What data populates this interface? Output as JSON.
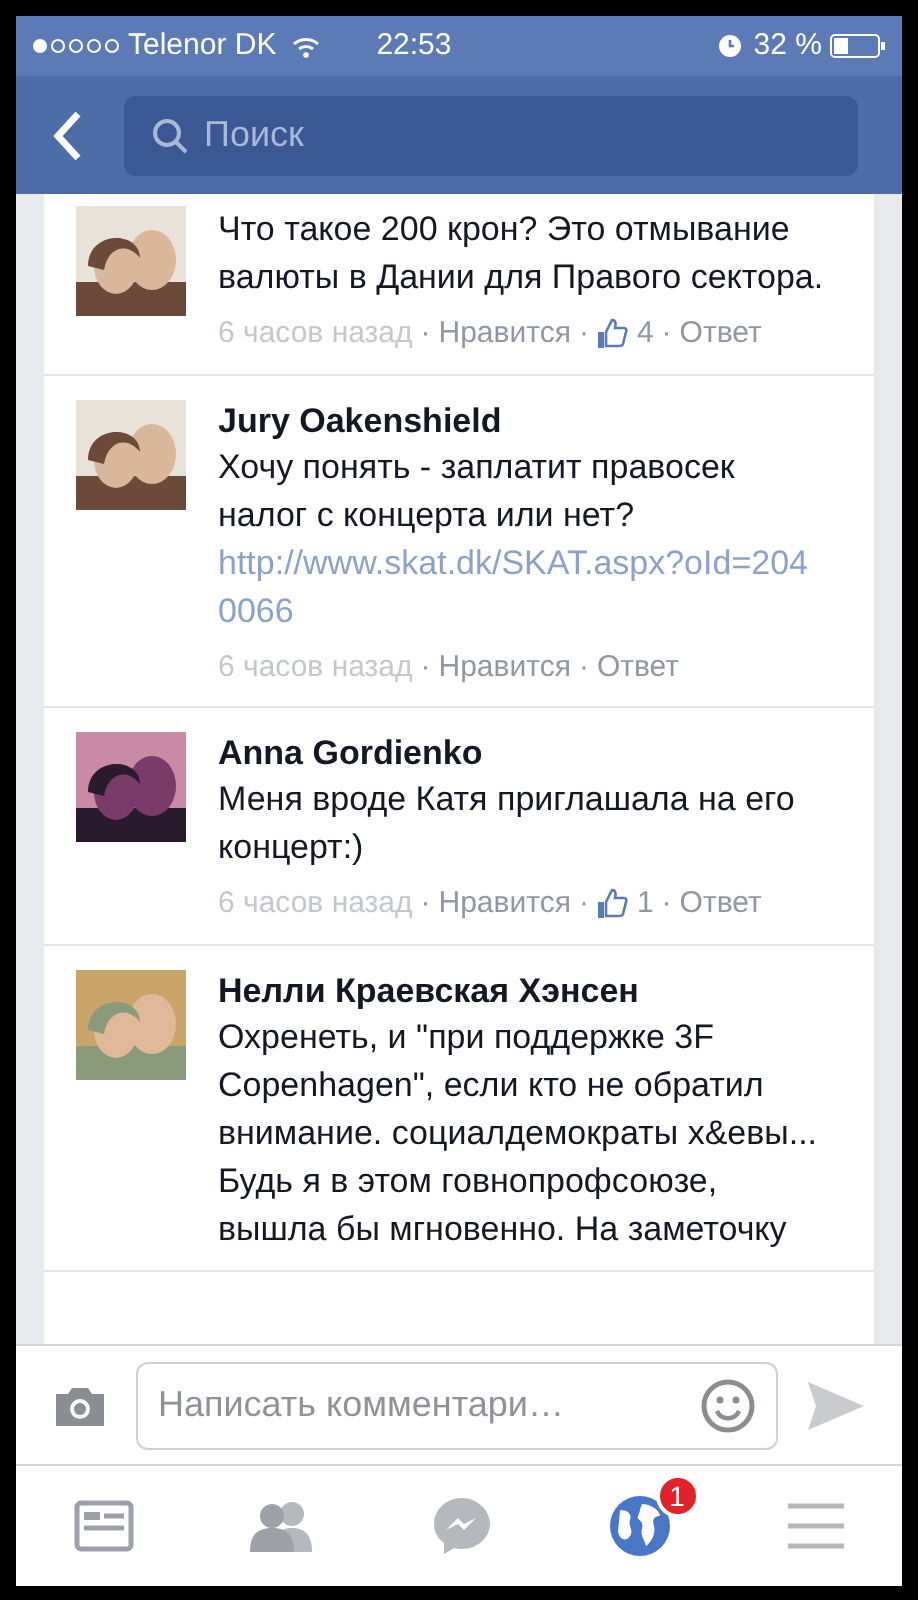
{
  "status_bar": {
    "carrier": "Telenor DK",
    "time": "22:53",
    "battery": "32 %"
  },
  "search": {
    "placeholder": "Поиск"
  },
  "comments": [
    {
      "text": "Что такое 200 крон? Это отмывание валюты в Дании для Правого сектора.",
      "meta": [
        {
          "kind": "time",
          "text": "6 часов назад"
        },
        {
          "kind": "sep",
          "text": "·"
        },
        {
          "kind": "like",
          "text": "Нравится"
        },
        {
          "kind": "sep",
          "text": "·"
        },
        {
          "kind": "likes",
          "text": "4"
        },
        {
          "kind": "sep",
          "text": "·"
        },
        {
          "kind": "reply",
          "text": "Ответ"
        }
      ]
    },
    {
      "author": "Jury Oakenshield",
      "text": "Хочу понять - заплатит правосек налог с концерта или нет?",
      "link": "http://www.skat.dk/SKAT.aspx?oId=2040066",
      "meta": [
        {
          "kind": "time",
          "text": "6 часов назад"
        },
        {
          "kind": "sep",
          "text": "·"
        },
        {
          "kind": "like",
          "text": "Нравится"
        },
        {
          "kind": "sep",
          "text": "·"
        },
        {
          "kind": "reply",
          "text": "Ответ"
        }
      ]
    },
    {
      "author": "Anna Gordienko",
      "text": "Меня вроде Катя приглашала на его концерт:)",
      "meta": [
        {
          "kind": "time",
          "text": "6 часов назад"
        },
        {
          "kind": "sep",
          "text": "·"
        },
        {
          "kind": "like",
          "text": "Нравится"
        },
        {
          "kind": "sep",
          "text": "·"
        },
        {
          "kind": "likes",
          "text": "1"
        },
        {
          "kind": "sep",
          "text": "·"
        },
        {
          "kind": "reply",
          "text": "Ответ"
        }
      ]
    },
    {
      "author": "Нелли Краевская Хэнсен",
      "text": "Охренеть, и \"при поддержке 3F Copenhagen\", если кто не обратил внимание. социалдемократы х&евы... Будь я в этом говнопрофсоюзе, вышла бы мгновенно. На заметочку"
    }
  ],
  "composer": {
    "placeholder": "Написать комментари…"
  },
  "tab_bar": [
    {
      "kind": "feed"
    },
    {
      "kind": "friends"
    },
    {
      "kind": "messenger"
    },
    {
      "kind": "globe",
      "badge": "1"
    },
    {
      "kind": "menu"
    }
  ]
}
